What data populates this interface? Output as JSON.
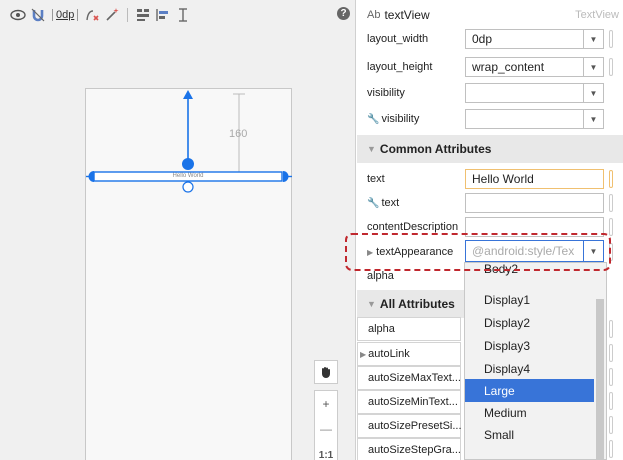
{
  "toolbar": {
    "icons": [
      "eye-icon",
      "magnet-icon",
      "path-icon",
      "wand-icon",
      "align-icon",
      "baseline-icon",
      "guide-icon"
    ],
    "default_margin": "0dp",
    "help": "?"
  },
  "canvas": {
    "text_view_label": "Hello World",
    "margin_value": "160"
  },
  "zoom": {
    "plus": "+",
    "minus": "—",
    "actual": "1:1"
  },
  "panel": {
    "widget_prefix": "Ab",
    "widget_name": "textView",
    "widget_class": "TextView"
  },
  "attrs": {
    "layout_width": {
      "label": "layout_width",
      "value": "0dp"
    },
    "layout_height": {
      "label": "layout_height",
      "value": "wrap_content"
    },
    "visibility": {
      "label": "visibility",
      "value": ""
    },
    "tool_visibility": {
      "label": "visibility",
      "value": ""
    }
  },
  "common": {
    "title": "Common Attributes",
    "text": {
      "label": "text",
      "value": "Hello World"
    },
    "tool_text": {
      "label": "text",
      "value": ""
    },
    "content_description": {
      "label": "contentDescription",
      "value": ""
    },
    "text_appearance": {
      "label": "textAppearance",
      "value": "@android:style/Tex"
    },
    "alpha": {
      "label": "alpha"
    }
  },
  "all": {
    "title": "All Attributes",
    "items": [
      "alpha",
      "autoLink",
      "autoSizeMaxText...",
      "autoSizeMinText...",
      "autoSizePresetSi...",
      "autoSizeStepGra..."
    ]
  },
  "dropdown": {
    "options": [
      "Body2",
      "Display1",
      "Display2",
      "Display3",
      "Display4",
      "Large",
      "Medium",
      "Small"
    ],
    "selected": "Large"
  },
  "colors": {
    "accent": "#3874d8",
    "blueprint": "#1a73e8",
    "highlight": "#c0282e"
  }
}
